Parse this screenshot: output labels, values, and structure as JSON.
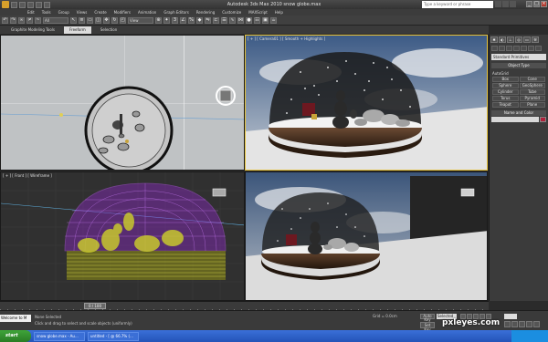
{
  "window": {
    "title": "Autodesk 3ds Max 2010   snow globe.max",
    "search_placeholder": "Type a keyword or phrase"
  },
  "menu": [
    "Edit",
    "Tools",
    "Group",
    "Views",
    "Create",
    "Modifiers",
    "Animation",
    "Graph Editors",
    "Rendering",
    "Customize",
    "MAXScript",
    "Help"
  ],
  "toolbar": {
    "selection_filter": "All",
    "ref_coord": "View"
  },
  "ribbon": {
    "tabs": [
      "Graphite Modeling Tools",
      "Freeform",
      "Selection"
    ],
    "active": "Freeform"
  },
  "viewports": {
    "top": "",
    "perspective": "[ + ] [ Camera01 ] [ Smooth + Highlights ]",
    "front": "[ + ] [ Front ] [ Wireframe ]",
    "camera": ""
  },
  "command_panel": {
    "category": "Standard Primitives",
    "object_type_title": "Object Type",
    "autogrid": "AutoGrid",
    "objects": [
      "Box",
      "Cone",
      "Sphere",
      "GeoSphere",
      "Cylinder",
      "Tube",
      "Torus",
      "Pyramid",
      "Teapot",
      "Plane"
    ],
    "name_color_title": "Name and Color",
    "color": "#b0203a"
  },
  "timeline": {
    "slider": "0 / 100"
  },
  "status": {
    "maxscript": "Welcome to M",
    "line1": "None Selected",
    "line2": "Click and drag to select and scale objects (uniformly)",
    "coords": "X:   Y:   Z:",
    "grid": "Grid = 0.0cm",
    "auto_key": "Auto Key",
    "set_key": "Set Key",
    "key_mode": "Selected",
    "add_time_tag": "Add Time Tag"
  },
  "taskbar": {
    "start": "start",
    "tasks": [
      "snow globe.max - Au...",
      "untitled - [ @ 66.7% (..."
    ]
  },
  "watermark": "pxleyes.com"
}
